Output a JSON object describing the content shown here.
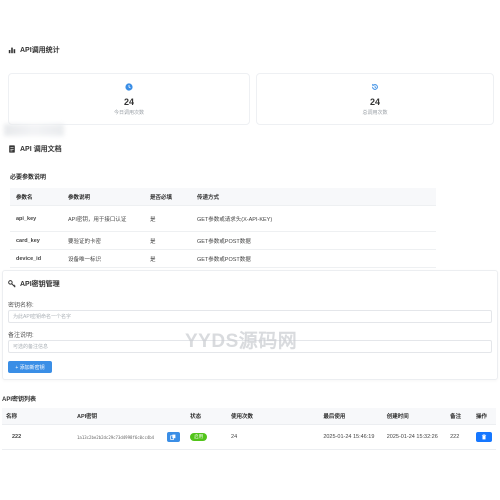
{
  "stats": {
    "title": "API调用统计",
    "cards": [
      {
        "value": "24",
        "label": "今日调用次数",
        "icon": "clock-icon"
      },
      {
        "value": "24",
        "label": "总调用次数",
        "icon": "history-icon"
      }
    ]
  },
  "docs": {
    "title": "API 调用文档",
    "subtitle": "必要参数说明",
    "columns": [
      "参数名",
      "参数说明",
      "是否必填",
      "传递方式"
    ],
    "rows": [
      {
        "name": "api_key",
        "desc": "API密钥，用于接口认证",
        "required": "是",
        "method": "GET参数或请求头(X-API-KEY)"
      },
      {
        "name": "card_key",
        "desc": "要验证的卡密",
        "required": "是",
        "method": "GET参数或POST数据"
      },
      {
        "name": "device_id",
        "desc": "设备唯一标识",
        "required": "是",
        "method": "GET参数或POST数据"
      }
    ]
  },
  "key_manage": {
    "title": "API密钥管理",
    "name_label": "密钥名称:",
    "name_placeholder": "为此API密钥命名一个名字",
    "note_label": "备注说明:",
    "note_placeholder": "可选的备注信息",
    "add_button": "+ 添加新密钥"
  },
  "key_list": {
    "title": "API密钥列表",
    "columns": [
      "名称",
      "API密钥",
      "状态",
      "使用次数",
      "最后使用",
      "创建时间",
      "备注",
      "操作"
    ],
    "rows": [
      {
        "name": "222",
        "key": "1a13c2be2b2dc29c73d4998f6c0cc4b4",
        "status": "启用",
        "uses": "24",
        "last_used": "2025-01-24 15:46:19",
        "created": "2025-01-24 15:32:26",
        "note": "222"
      }
    ]
  },
  "watermark": "YYDS源码网",
  "colors": {
    "primary": "#3a8ee6",
    "success": "#52c41a",
    "danger": "#1677ff"
  }
}
